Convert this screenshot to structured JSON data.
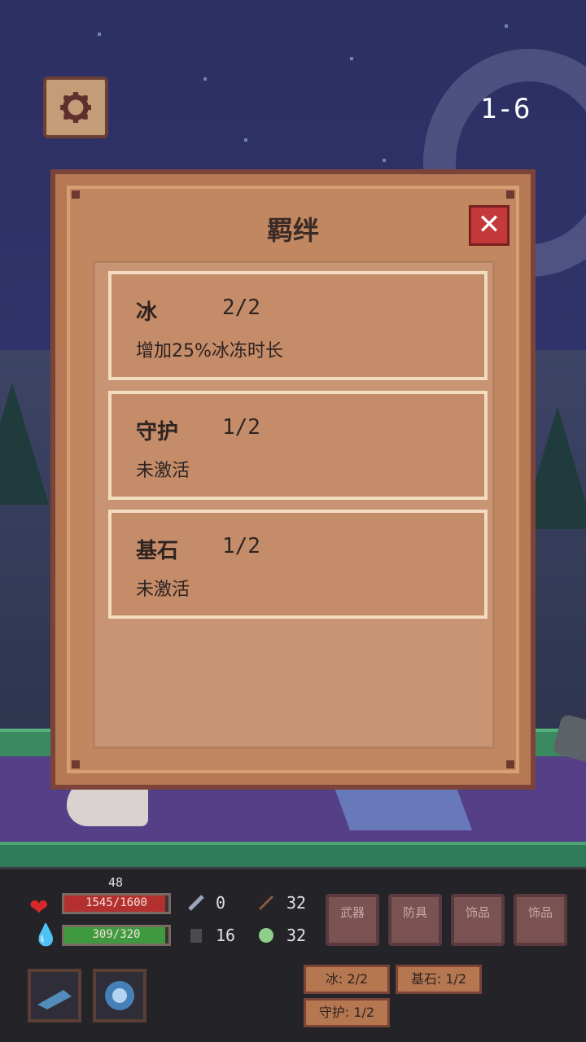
{
  "stage": "1-6",
  "modal": {
    "title": "羁绊",
    "close_label": "✕",
    "bonds": [
      {
        "name": "冰",
        "count": "2/2",
        "desc": "增加25%冰冻时长"
      },
      {
        "name": "守护",
        "count": "1/2",
        "desc": "未激活"
      },
      {
        "name": "基石",
        "count": "1/2",
        "desc": "未激活"
      }
    ]
  },
  "hud": {
    "level": "48",
    "hp_text": "1545/1600",
    "hp_fraction": 0.966,
    "mp_text": "309/320",
    "mp_fraction": 0.966,
    "attack": "0",
    "defense": "16",
    "range": "32",
    "speed": "32",
    "slots": [
      {
        "label": "武器"
      },
      {
        "label": "防具"
      },
      {
        "label": "饰品"
      },
      {
        "label": "饰品"
      }
    ],
    "tags": [
      {
        "label": "冰: 2/2"
      },
      {
        "label": "基石: 1/2"
      },
      {
        "label": "守护: 1/2"
      }
    ]
  },
  "colors": {
    "hp": "#b3302f",
    "mp": "#3f9a3f",
    "panel": "#b57954",
    "close": "#c43a3a"
  }
}
